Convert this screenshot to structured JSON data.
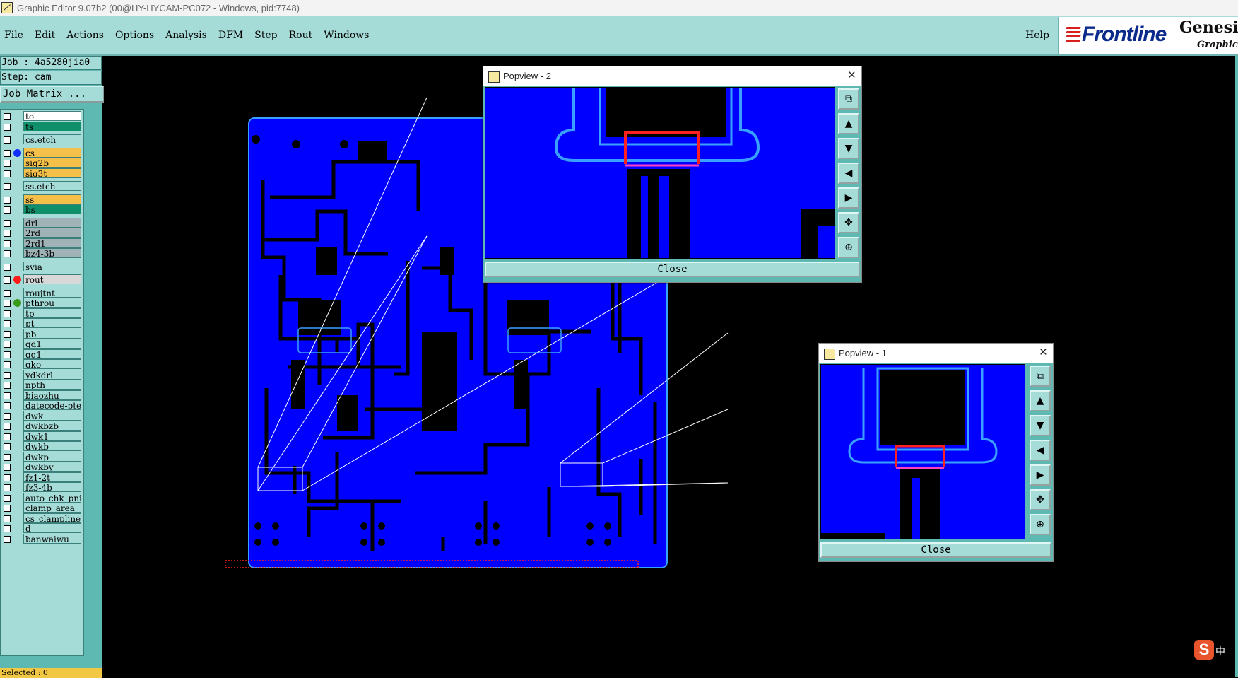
{
  "window": {
    "title": "Graphic Editor 9.07b2 (00@HY-HYCAM-PC072 - Windows, pid:7748)"
  },
  "menu": {
    "items": [
      "File",
      "Edit",
      "Actions",
      "Options",
      "Analysis",
      "DFM",
      "Step",
      "Rout",
      "Windows"
    ],
    "help": "Help"
  },
  "logo": {
    "brand": "Frontline",
    "product": "Genesis",
    "subtitle": "Graphic E"
  },
  "job": {
    "job_line": "Job : 4a5280jia0",
    "step_line": "Step: cam",
    "matrix_button": "Job Matrix ..."
  },
  "layers": [
    {
      "name": "to",
      "color": "#ffffff",
      "dot": ""
    },
    {
      "name": "ts",
      "color": "#0f8f6a",
      "dot": ""
    },
    {
      "name": "cs.etch",
      "color": "#a6dcd8",
      "dot": ""
    },
    {
      "name": "cs",
      "color": "#f5c04a",
      "dot": "#1030ff"
    },
    {
      "name": "sig2b",
      "color": "#f5c04a",
      "dot": ""
    },
    {
      "name": "sig3t",
      "color": "#f5c04a",
      "dot": ""
    },
    {
      "name": "ss.etch",
      "color": "#a6dcd8",
      "dot": ""
    },
    {
      "name": "ss",
      "color": "#f5c04a",
      "dot": ""
    },
    {
      "name": "bs",
      "color": "#0f8f6a",
      "dot": ""
    },
    {
      "name": "drl",
      "color": "#9fb2b6",
      "dot": ""
    },
    {
      "name": "2rd",
      "color": "#9fb2b6",
      "dot": ""
    },
    {
      "name": "2rd1",
      "color": "#9fb2b6",
      "dot": ""
    },
    {
      "name": "bz4-3b",
      "color": "#9fb2b6",
      "dot": ""
    },
    {
      "name": "svia",
      "color": "#a6dcd8",
      "dot": ""
    },
    {
      "name": "rout",
      "color": "#d8d8d8",
      "dot": "#ff1a1a"
    },
    {
      "name": "roujtnt",
      "color": "#a6dcd8",
      "dot": ""
    },
    {
      "name": "pthrou",
      "color": "#a6dcd8",
      "dot": "#3a9a1a"
    },
    {
      "name": "tp",
      "color": "#a6dcd8",
      "dot": ""
    },
    {
      "name": "pt",
      "color": "#a6dcd8",
      "dot": ""
    },
    {
      "name": "pb",
      "color": "#a6dcd8",
      "dot": ""
    },
    {
      "name": "gd1",
      "color": "#a6dcd8",
      "dot": ""
    },
    {
      "name": "gg1",
      "color": "#a6dcd8",
      "dot": ""
    },
    {
      "name": "gko",
      "color": "#a6dcd8",
      "dot": ""
    },
    {
      "name": "ydkdrl",
      "color": "#a6dcd8",
      "dot": ""
    },
    {
      "name": "npth",
      "color": "#a6dcd8",
      "dot": ""
    },
    {
      "name": "biaozhu",
      "color": "#a6dcd8",
      "dot": ""
    },
    {
      "name": "datecode-pte",
      "color": "#a6dcd8",
      "dot": ""
    },
    {
      "name": "dwk",
      "color": "#a6dcd8",
      "dot": ""
    },
    {
      "name": "dwkbzb",
      "color": "#a6dcd8",
      "dot": ""
    },
    {
      "name": "dwk1",
      "color": "#a6dcd8",
      "dot": ""
    },
    {
      "name": "dwkb",
      "color": "#a6dcd8",
      "dot": ""
    },
    {
      "name": "dwkp",
      "color": "#a6dcd8",
      "dot": ""
    },
    {
      "name": "dwkby",
      "color": "#a6dcd8",
      "dot": ""
    },
    {
      "name": "fz1-2t",
      "color": "#a6dcd8",
      "dot": ""
    },
    {
      "name": "fz3-4b",
      "color": "#a6dcd8",
      "dot": ""
    },
    {
      "name": "auto_chk_pni",
      "color": "#a6dcd8",
      "dot": ""
    },
    {
      "name": "clamp_area",
      "color": "#a6dcd8",
      "dot": ""
    },
    {
      "name": "cs_clampline",
      "color": "#a6dcd8",
      "dot": ""
    },
    {
      "name": "d",
      "color": "#a6dcd8",
      "dot": ""
    },
    {
      "name": "banwaiwu",
      "color": "#a6dcd8",
      "dot": ""
    }
  ],
  "status": {
    "selected": "Selected : 0"
  },
  "popview2": {
    "title": "Popview - 2",
    "close_x": "×",
    "close_button": "Close"
  },
  "popview1": {
    "title": "Popview - 1",
    "close_x": "×",
    "close_button": "Close"
  },
  "ime": {
    "logo": "S",
    "mode": "中"
  },
  "colors": {
    "board": "#0000ff",
    "panel": "#a6dcd8",
    "accent": "#5fb9b3"
  }
}
